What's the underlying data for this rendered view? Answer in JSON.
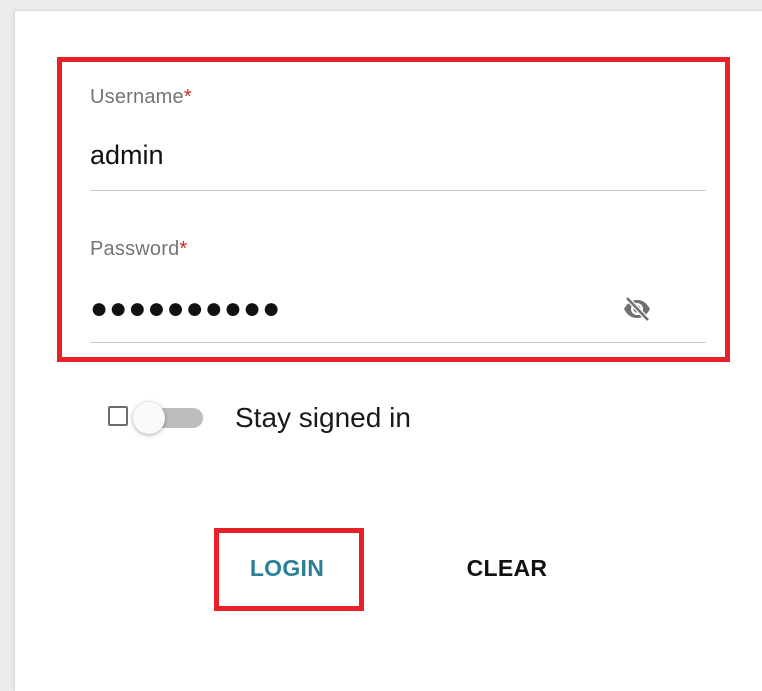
{
  "form": {
    "username": {
      "label": "Username",
      "required_mark": "*",
      "value": "admin"
    },
    "password": {
      "label": "Password",
      "required_mark": "*",
      "masked_value": "●●●●●●●●●●",
      "visibility_icon": "eye-off-icon"
    },
    "stay_signed_in": {
      "label": "Stay signed in",
      "checked": false
    },
    "buttons": {
      "login": "LOGIN",
      "clear": "CLEAR"
    }
  },
  "colors": {
    "highlight": "#e8202a",
    "login_text": "#2a7f99",
    "required_mark": "#c62828",
    "label_gray": "#757575"
  }
}
